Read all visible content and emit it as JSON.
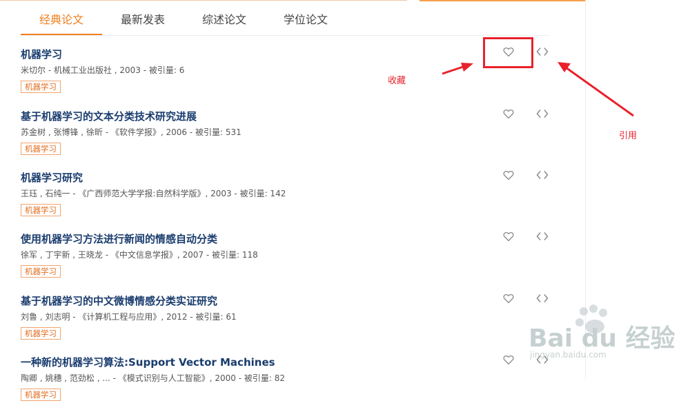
{
  "tabs": [
    {
      "label": "经典论文",
      "active": true
    },
    {
      "label": "最新发表",
      "active": false
    },
    {
      "label": "综述论文",
      "active": false
    },
    {
      "label": "学位论文",
      "active": false
    }
  ],
  "papers": [
    {
      "title": "机器学习",
      "meta": "米切尔 - 机械工业出版社 , 2003 - 被引量: 6",
      "tag": "机器学习"
    },
    {
      "title": "基于机器学习的文本分类技术研究进展",
      "meta": "苏金树 , 张博锋 , 徐昕 - 《软件学报》, 2006 - 被引量: 531",
      "tag": "机器学习"
    },
    {
      "title": "机器学习研究",
      "meta": "王珏 , 石纯一 - 《广西师范大学学报:自然科学版》, 2003 - 被引量: 142",
      "tag": "机器学习"
    },
    {
      "title": "使用机器学习方法进行新闻的情感自动分类",
      "meta": "徐军 , 丁宇新 , 王晓龙 - 《中文信息学报》, 2007 - 被引量: 118",
      "tag": "机器学习"
    },
    {
      "title": "基于机器学习的中文微博情感分类实证研究",
      "meta": "刘鲁 , 刘志明 - 《计算机工程与应用》, 2012 - 被引量: 61",
      "tag": "机器学习"
    },
    {
      "title": "一种新的机器学习算法:Support Vector Machines",
      "meta": "陶卿 , 姚穗 , 范劲松 , ... - 《模式识别与人工智能》, 2000 - 被引量: 82",
      "tag": "机器学习"
    }
  ],
  "annotations": {
    "favorite_label": "收藏",
    "cite_label": "引用"
  },
  "icons": {
    "favorite": "heart-outline-icon",
    "cite": "code-brackets-icon"
  },
  "colors": {
    "accent": "#f07f1e",
    "title": "#1a3c6e",
    "annotation": "#e8212b"
  },
  "watermark": {
    "brand": "Bai du 经验",
    "url": "jingyan.baidu.com"
  }
}
